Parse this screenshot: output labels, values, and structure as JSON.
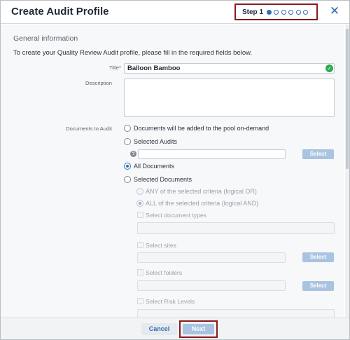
{
  "header": {
    "title": "Create Audit Profile",
    "step_label": "Step 1",
    "steps_total": 6,
    "current_step": 1,
    "close_glyph": "✕"
  },
  "form": {
    "section_title": "General information",
    "intro": "To create your Quality Review Audit profile, please fill in the required fields below.",
    "title_label": "Title",
    "title_required_mark": "*",
    "title_value": "Balloon Bamboo",
    "description_label": "Description",
    "description_value": "",
    "documents_label": "Documents to Audit",
    "options": {
      "on_demand": "Documents will be added to the pool on-demand",
      "selected_audits": "Selected Audits",
      "all_documents": "All Documents",
      "selected_documents": "Selected Documents",
      "any_criteria": "ANY of the selected criteria (logical OR)",
      "all_criteria": "ALL of the selected criteria (logical AND)"
    },
    "selected_option": "all_documents",
    "criteria_mode": "all_criteria",
    "criteria": {
      "document_types": "Select document types",
      "sites": "Select sites",
      "folders": "Select folders",
      "risk_levels": "Select Risk Levels"
    },
    "select_button_label": "Select",
    "info_icon_glyph": "?"
  },
  "footer": {
    "cancel_label": "Cancel",
    "next_label": "Next"
  },
  "colors": {
    "accent": "#2f6fb3",
    "highlight_border": "#8b1a1a",
    "disabled_button": "#a9c3e0",
    "success": "#2eaa55"
  }
}
